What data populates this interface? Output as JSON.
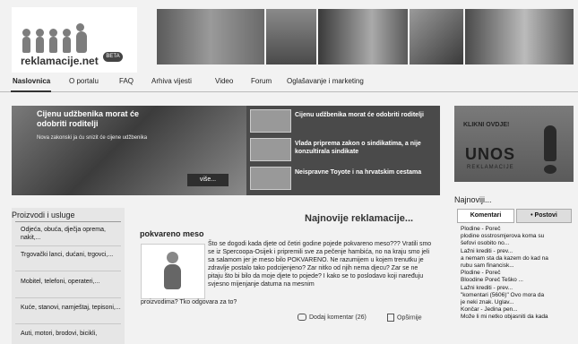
{
  "logo": {
    "text": "reklamacije.net",
    "badge": "BETA"
  },
  "nav": [
    "Naslovnica",
    "O portalu",
    "FAQ",
    "Arhiva vijesti",
    "Video",
    "Forum",
    "Oglašavanje i marketing"
  ],
  "featured": {
    "title": "Cijenu udžbenika morat će odobriti roditelji",
    "subtitle": "Nova zakonski ja ću snizit će cijene udžbenika",
    "more": "više...",
    "items": [
      "Cijenu udžbenika morat će odobriti roditelji",
      "Vlada priprema zakon o sindikatima, a nije konzultirala sindikate",
      "Neispravne Toyote i na hrvatskim cestama"
    ]
  },
  "ad": {
    "click": "KLIKNI OVDJE!",
    "unos": "UNOS",
    "reklamacije": "REKLAMACIJE"
  },
  "categories": {
    "title": "Proizvodi i usluge",
    "items": [
      "Odjeća, obuća, dječja oprema, nakit,...",
      "Trgovački lanci, dućani, trgovci,...",
      "Mobitel, telefoni, operateri,...",
      "Kuće, stanovi, namještaj, tepisoni,...",
      "Auti, motori, brodovi, bicikli,"
    ]
  },
  "main": {
    "heading": "Najnovije reklamacije...",
    "post_title": "pokvareno meso",
    "post_body": "Što se dogodi kada djete od četiri godine pojede pokvareno meso??? Vratili smo se iz Spercoopa-Osijek i pripremili sve za pečenje hambića, no na kraju smo jeli sa salamom jer je meso bilo POKVARENO. Ne razumijem u kojem trenutku je zdravlje postalo tako podcijenjeno? Zar nitko od njih nema djecu? Zar se ne pitaju što bi bilo da moje djete to pojede? I kako se to poslodavo koji naređuju svjesno mijenjanje datuma na mesnim",
    "post_body_end": "proizvodima? Tko odgovara za to?",
    "comments": "Dodaj komentar (26)",
    "opinion": "Opširnije"
  },
  "latest": {
    "title": "Najnoviji...",
    "tabs": [
      "Komentari",
      "Postovi"
    ],
    "items": [
      "Plodine - Poreč",
      "plodine osstrosmjerova koma su",
      "šefovi osobito no...",
      "Lažni krediti - prev...",
      "a nemam sta da kazem do kad na",
      "rubu sam financisk...",
      "Plodine - Poreč",
      "Bloodine Poreč Teško ...",
      "Lažni krediti - prev...",
      "\"komentari (5606)\" Ovo mora da",
      "je neki znak. Uglav...",
      "Končar - Jedina pen...",
      "Može li mi netko objasniti da kada"
    ]
  },
  "colors": {
    "page_bg": "#f2f2f2",
    "feature_bg": "#4a4a4a",
    "ad_bg": "#6a6a6a"
  }
}
